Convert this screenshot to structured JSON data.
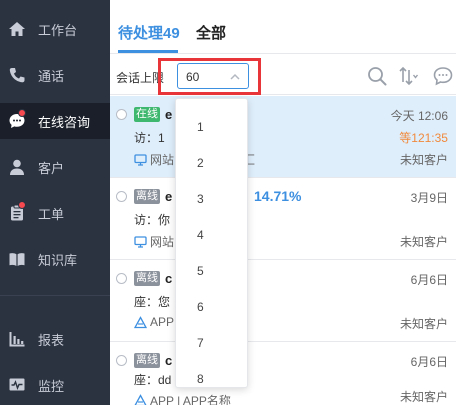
{
  "sidebar": {
    "items": [
      {
        "label": "工作台",
        "icon": "home-icon"
      },
      {
        "label": "通话",
        "icon": "phone-icon"
      },
      {
        "label": "在线咨询",
        "icon": "chat-icon"
      },
      {
        "label": "客户",
        "icon": "user-icon"
      },
      {
        "label": "工单",
        "icon": "ticket-icon"
      },
      {
        "label": "知识库",
        "icon": "book-icon"
      },
      {
        "label": "报表",
        "icon": "bar-chart-icon"
      },
      {
        "label": "监控",
        "icon": "monitor-icon"
      }
    ]
  },
  "tabs": [
    {
      "label": "待处理49"
    },
    {
      "label": "全部"
    }
  ],
  "filter": {
    "label": "会话上限",
    "select_value": "60"
  },
  "dropdown": {
    "options": [
      "1",
      "2",
      "3",
      "4",
      "5",
      "6",
      "7",
      "8"
    ]
  },
  "sessions": [
    {
      "status": "在线",
      "name": "e",
      "time": "今天 12:06",
      "preview": "访：1",
      "wait": "等121:35",
      "source": "网站",
      "source_extra": "汇",
      "customer": "未知客户"
    },
    {
      "status": "离线",
      "name": "e",
      "percent": "14.71%",
      "time": "3月9日",
      "preview": "访：你",
      "source": "网站",
      "customer": "未知客户"
    },
    {
      "status": "离线",
      "name": "c",
      "time": "6月6日",
      "preview": "座：您",
      "source": "APP",
      "customer": "未知客户"
    },
    {
      "status": "离线",
      "name": "c",
      "time": "6月6日",
      "preview": "座：dd",
      "source": "APP | APP名称",
      "customer": "未知客户"
    }
  ],
  "colors": {
    "sidebar_bg": "#2b3240",
    "accent": "#3d8fe0",
    "online": "#3fb86f",
    "offline": "#8c929c",
    "wait": "#f08a3c",
    "highlight_box": "#e8353a"
  }
}
